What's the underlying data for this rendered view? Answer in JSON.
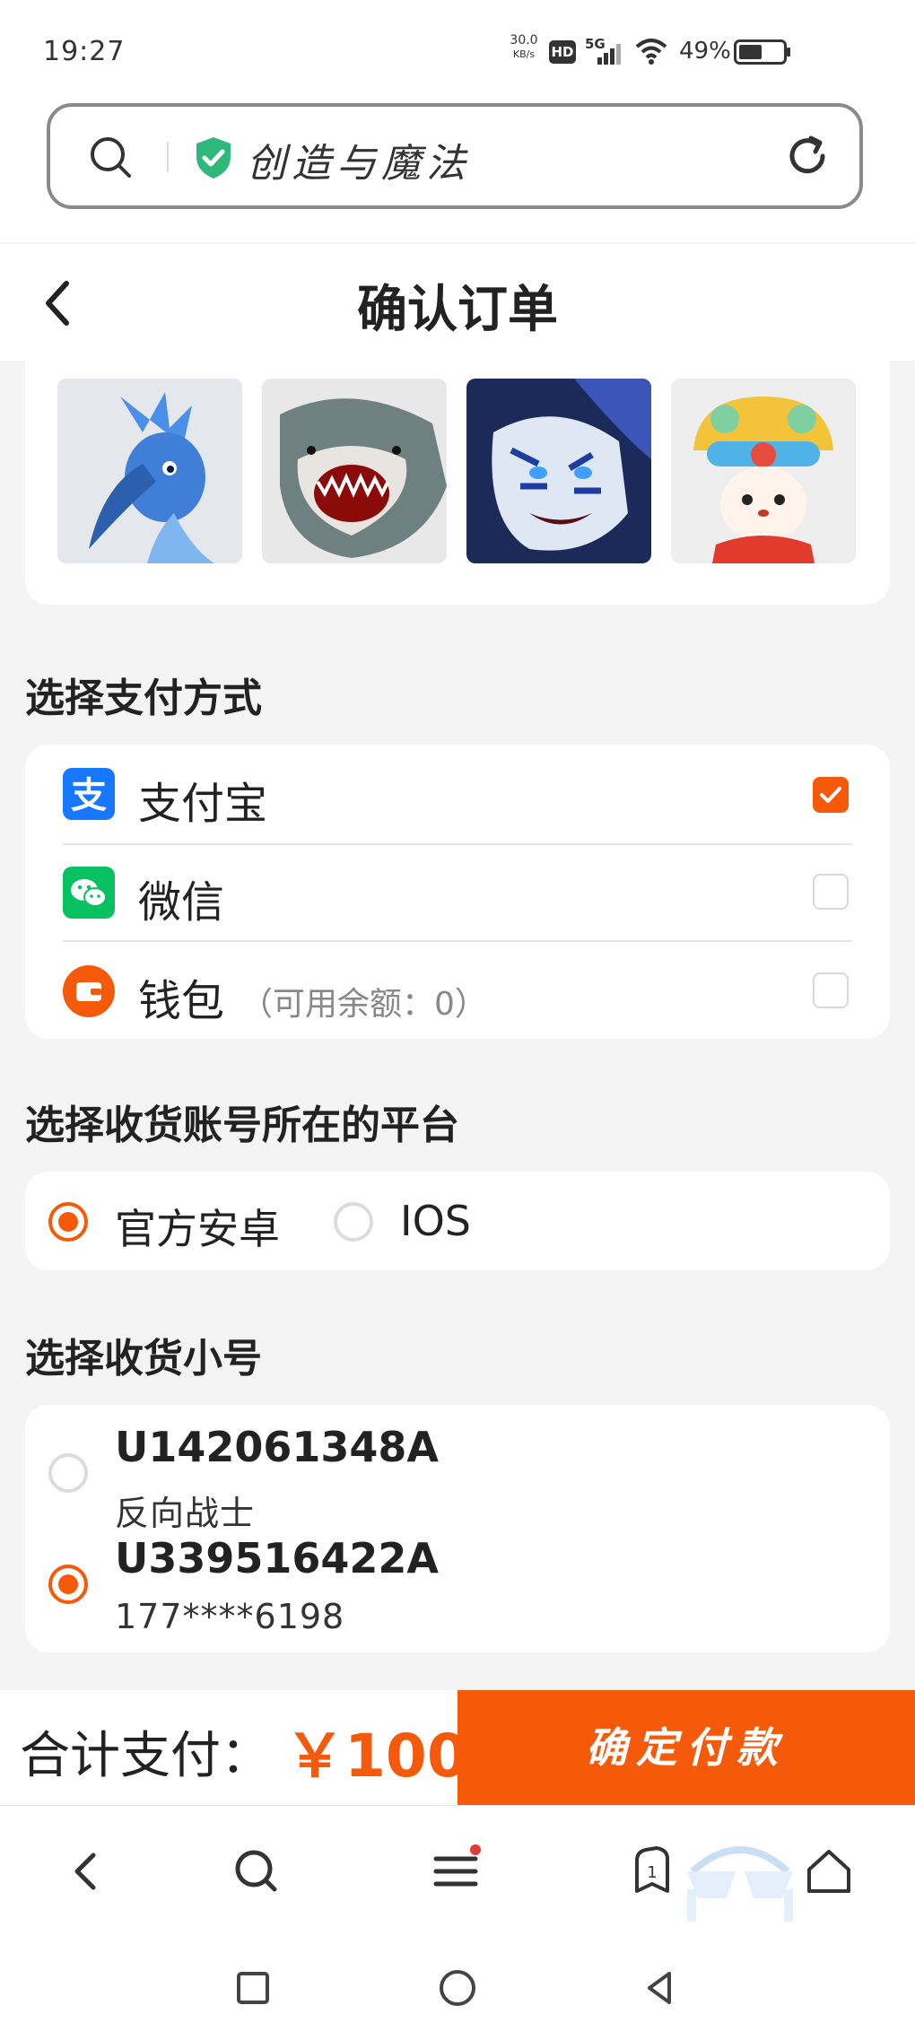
{
  "status_bar": {
    "time": "19:27",
    "net_speed_value": "30.0",
    "net_speed_unit": "KB/s",
    "hd": "HD",
    "network": "5G",
    "battery": "49%"
  },
  "address_bar": {
    "site_title": "创造与魔法"
  },
  "header": {
    "title": "确认订单"
  },
  "items": [
    {
      "icon": "blue-bird-character"
    },
    {
      "icon": "shark-mount"
    },
    {
      "icon": "white-tiger-mount"
    },
    {
      "icon": "lion-dance-doll"
    }
  ],
  "payment": {
    "section_title": "选择支付方式",
    "options": [
      {
        "label": "支付宝",
        "note": "",
        "checked": true,
        "icon": "alipay-icon"
      },
      {
        "label": "微信",
        "note": "",
        "checked": false,
        "icon": "wechat-icon"
      },
      {
        "label": "钱包",
        "note": "（可用余额：0）",
        "checked": false,
        "icon": "wallet-icon"
      }
    ]
  },
  "platform": {
    "section_title": "选择收货账号所在的平台",
    "options": [
      {
        "label": "官方安卓",
        "selected": true
      },
      {
        "label": "IOS",
        "selected": false
      }
    ]
  },
  "accounts": {
    "section_title": "选择收货小号",
    "list": [
      {
        "id": "U142061348A",
        "sub": "反向战士",
        "selected": false
      },
      {
        "id": "U339516422A",
        "sub": "177****6198",
        "selected": true
      }
    ]
  },
  "footer": {
    "total_label": "合计支付：",
    "total_amount": "￥100",
    "confirm_label": "确定付款"
  },
  "browser_nav": {
    "tabs_count": "1"
  },
  "colors": {
    "accent": "#f55a0a",
    "alipay": "#1677ff",
    "wechat": "#07c160"
  }
}
